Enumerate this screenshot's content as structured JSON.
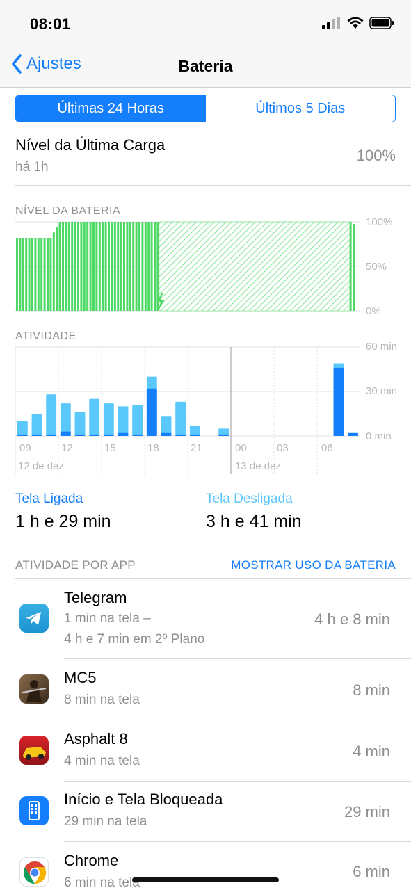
{
  "status": {
    "time": "08:01"
  },
  "nav": {
    "back_label": "Ajustes",
    "title": "Bateria"
  },
  "segments": {
    "items": [
      "Últimas 24 Horas",
      "Últimos 5 Dias"
    ],
    "selected_index": 0
  },
  "last_charge": {
    "label": "Nível da Última Carga",
    "time": "há 1h",
    "value": "100%"
  },
  "battery_chart": {
    "section_label": "NÍVEL DA BATERIA",
    "y_ticks": [
      "100%",
      "50%",
      "0%"
    ]
  },
  "activity_chart": {
    "section_label": "ATIVIDADE",
    "y_ticks": [
      "60 min",
      "30 min",
      "0 min"
    ],
    "x_ticks": [
      "09",
      "12",
      "15",
      "18",
      "21",
      "00",
      "03",
      "06"
    ],
    "date_labels": [
      "12 de dez",
      "13 de dez"
    ]
  },
  "chart_data": [
    {
      "type": "area",
      "title": "NÍVEL DA BATERIA",
      "ylabel": "",
      "ylim": [
        0,
        100
      ],
      "y_unit": "%",
      "x_unit": "hour_slot_index",
      "values": [
        82,
        82,
        82,
        82,
        82,
        82,
        82,
        82,
        82,
        82,
        82,
        82,
        82,
        82,
        82,
        82,
        82,
        82,
        82,
        82,
        82,
        82,
        82,
        82,
        82,
        82,
        82,
        82,
        82,
        82,
        82,
        82,
        82,
        82,
        82,
        82,
        82,
        82,
        82,
        82,
        82,
        82,
        82,
        82,
        82,
        82,
        82,
        82,
        82,
        82,
        82,
        82,
        82,
        82,
        82,
        82,
        82,
        82,
        82,
        82,
        82,
        82,
        82,
        82,
        82,
        82,
        82,
        82,
        82,
        82,
        82,
        82,
        82,
        82,
        82,
        82,
        82,
        82,
        82,
        82,
        82,
        82,
        82,
        82,
        82,
        82,
        82,
        82,
        82,
        82,
        82,
        82,
        82,
        82,
        82,
        82,
        82,
        82,
        82,
        82,
        82,
        82,
        82,
        82,
        82,
        82,
        82,
        82,
        82,
        82,
        82,
        82,
        82,
        82,
        82,
        82,
        82,
        82,
        82,
        82,
        82,
        82,
        82,
        82,
        82,
        82,
        82,
        82,
        82,
        82,
        82,
        82,
        82,
        82,
        82,
        82,
        82,
        82,
        82,
        82,
        82,
        82,
        82,
        82,
        82,
        82,
        82,
        82,
        82,
        82,
        82,
        82,
        82,
        82,
        82,
        82,
        82,
        82,
        82,
        82,
        82,
        82,
        82,
        82,
        82,
        82,
        82,
        82,
        82,
        82,
        82,
        82,
        82,
        82,
        82,
        82,
        82,
        82,
        82,
        82,
        82,
        82,
        82,
        82,
        82,
        82,
        82,
        82,
        82,
        82,
        82,
        82,
        82,
        82,
        82,
        82,
        82,
        82,
        82,
        82,
        82,
        82,
        82,
        82,
        82,
        82,
        82,
        82,
        82,
        82,
        82,
        82,
        82,
        82,
        82,
        82,
        82,
        82,
        82,
        82,
        82,
        82,
        82,
        82,
        82,
        82,
        82,
        82,
        82,
        82,
        82,
        82,
        82,
        82,
        82,
        82,
        82,
        82,
        82,
        82,
        82,
        82,
        82,
        82,
        82,
        82,
        82,
        82,
        82,
        82,
        82,
        82,
        82,
        82,
        82,
        82,
        82,
        82,
        82,
        82,
        82,
        82,
        82,
        82,
        82,
        82,
        82,
        82,
        82,
        82,
        82,
        82,
        82,
        82,
        82,
        82,
        82,
        82,
        82,
        82,
        82,
        82,
        82,
        82,
        82,
        82,
        82,
        82,
        82,
        82,
        82,
        82,
        82,
        82,
        82,
        82,
        82,
        82,
        82,
        82,
        82,
        82,
        82,
        82,
        82,
        82,
        82,
        82,
        82,
        82,
        82,
        82,
        82,
        82
      ],
      "solid_profile": [
        82,
        82,
        82,
        82,
        82,
        82,
        82,
        82,
        82,
        82,
        82,
        82,
        82,
        82,
        82,
        82,
        82,
        82,
        82,
        82,
        82,
        82,
        82,
        82,
        82,
        82,
        82,
        82,
        82,
        82,
        82,
        82,
        82,
        82,
        82,
        82,
        82,
        82,
        82,
        82,
        82,
        82,
        82,
        82,
        82,
        82,
        82,
        82,
        82,
        82,
        82,
        82,
        82,
        82,
        82,
        82,
        82,
        82,
        82,
        82,
        82,
        82,
        82,
        82,
        82,
        82,
        82,
        82,
        82,
        82,
        82,
        82,
        82,
        82,
        82,
        82,
        82,
        82,
        82,
        82,
        82,
        82,
        82,
        82,
        82,
        82,
        82,
        82,
        82,
        82,
        82,
        82,
        82,
        82,
        82,
        82,
        82,
        82,
        82,
        82,
        82,
        82,
        82,
        82,
        82,
        82,
        82,
        82,
        82,
        82,
        82,
        82,
        82,
        82,
        82,
        82,
        82,
        82,
        82,
        82,
        82,
        82,
        82,
        82,
        82,
        82,
        82,
        82,
        82,
        82,
        82,
        82,
        82,
        82,
        82,
        82,
        82,
        82,
        82,
        82,
        82,
        82,
        82,
        82,
        82,
        82,
        82,
        82,
        82,
        82,
        82,
        82,
        82,
        82,
        82,
        82,
        82,
        82,
        82,
        82,
        82,
        82,
        82,
        82,
        82,
        82,
        82,
        82,
        82,
        82,
        82,
        82,
        82,
        82,
        82,
        82,
        82,
        82,
        82,
        82,
        82,
        82,
        82,
        82,
        82,
        82,
        82,
        82,
        82,
        82,
        82,
        82,
        82,
        82,
        82,
        82,
        82,
        82,
        82,
        82,
        82,
        82,
        82,
        82,
        82,
        82,
        82,
        82,
        82,
        82,
        82,
        82,
        82,
        82,
        82,
        82,
        82,
        82,
        82,
        82,
        82,
        82,
        82,
        82,
        82,
        82,
        82,
        82,
        82,
        82,
        82,
        82,
        82,
        82,
        82,
        82,
        82,
        82,
        82,
        82,
        82,
        82,
        82,
        82,
        82,
        82,
        82,
        82,
        82,
        82,
        82,
        82,
        82,
        82,
        82,
        82,
        82,
        82,
        82,
        82,
        82,
        82,
        82,
        82,
        82,
        82,
        82,
        82,
        82,
        82,
        82,
        82,
        82,
        82,
        82,
        82,
        82,
        82,
        82,
        82,
        82,
        82,
        82,
        82,
        82,
        82,
        82,
        82,
        82,
        82,
        82,
        82,
        82,
        82,
        82,
        82,
        82,
        82,
        82,
        82,
        82,
        82
      ],
      "points": [
        {
          "x": 0,
          "y": 82
        },
        {
          "x": 2.4,
          "y": 82
        },
        {
          "x": 3,
          "y": 100
        },
        {
          "x": 10,
          "y": 100
        },
        {
          "x": 20,
          "y": 100
        },
        {
          "x": 23.3,
          "y": 100
        },
        {
          "x": 23.6,
          "y": 96
        }
      ],
      "charging_hatched_range": [
        10,
        23.3
      ],
      "colors": {
        "level": "#4cd964",
        "charging": "#4cd964"
      }
    },
    {
      "type": "bar",
      "title": "ATIVIDADE",
      "ylabel": "",
      "ylim": [
        0,
        60
      ],
      "y_unit": "min",
      "categories": [
        "08",
        "09",
        "10",
        "11",
        "12",
        "13",
        "14",
        "15",
        "16",
        "17",
        "18",
        "19",
        "20",
        "21",
        "22",
        "23",
        "00",
        "01",
        "02",
        "03",
        "04",
        "05",
        "06",
        "07"
      ],
      "series": [
        {
          "name": "Tela Ligada",
          "values": [
            0,
            10,
            15,
            28,
            22,
            16,
            25,
            22,
            20,
            21,
            40,
            13,
            23,
            7,
            0,
            5,
            0,
            0,
            0,
            0,
            0,
            0,
            0,
            0
          ]
        },
        {
          "name": "Tela Desligada",
          "values": [
            0,
            0,
            0,
            0,
            0,
            0,
            0,
            0,
            0,
            0,
            0,
            0,
            0,
            0,
            0,
            0,
            0,
            0,
            0,
            0,
            0,
            0,
            0,
            0
          ]
        }
      ],
      "screen_on_light": [
        10,
        15,
        28,
        22,
        16,
        25,
        22,
        20,
        21,
        40,
        13,
        23,
        7,
        0,
        5,
        0,
        0,
        0,
        0,
        0,
        0,
        0,
        49,
        0
      ],
      "screen_on_dark": [
        1,
        1,
        1,
        3,
        1,
        1,
        1,
        2,
        1,
        32,
        2,
        1,
        1,
        0,
        1,
        0,
        0,
        0,
        0,
        0,
        0,
        0,
        46,
        2
      ],
      "x_ticks": [
        "09",
        "12",
        "15",
        "18",
        "21",
        "00",
        "03",
        "06"
      ],
      "colors": {
        "light": "#5ac8fa",
        "dark": "#157efb"
      }
    }
  ],
  "summary": {
    "on_label": "Tela Ligada",
    "on_value": "1 h e 29 min",
    "off_label": "Tela Desligada",
    "off_value": "3 h e 41 min"
  },
  "apps": {
    "header": "ATIVIDADE POR APP",
    "link": "MOSTRAR USO DA BATERIA",
    "items": [
      {
        "name": "Telegram",
        "sub1": "1 min na tela –",
        "sub2": "4 h e 7 min em 2º Plano",
        "time": "4 h e 8 min",
        "icon": "telegram-icon"
      },
      {
        "name": "MC5",
        "sub1": "8 min na tela",
        "time": "8 min",
        "icon": "mc5-icon"
      },
      {
        "name": "Asphalt 8",
        "sub1": "4 min na tela",
        "time": "4 min",
        "icon": "asphalt-icon"
      },
      {
        "name": "Início e Tela Bloqueada",
        "sub1": "29 min na tela",
        "time": "29 min",
        "icon": "home-lock-icon"
      },
      {
        "name": "Chrome",
        "sub1": "6 min na tela",
        "time": "6 min",
        "icon": "chrome-icon"
      }
    ]
  },
  "colors": {
    "accent": "#157efb",
    "battery_green": "#4cd964",
    "activity_light": "#5ac8fa"
  }
}
